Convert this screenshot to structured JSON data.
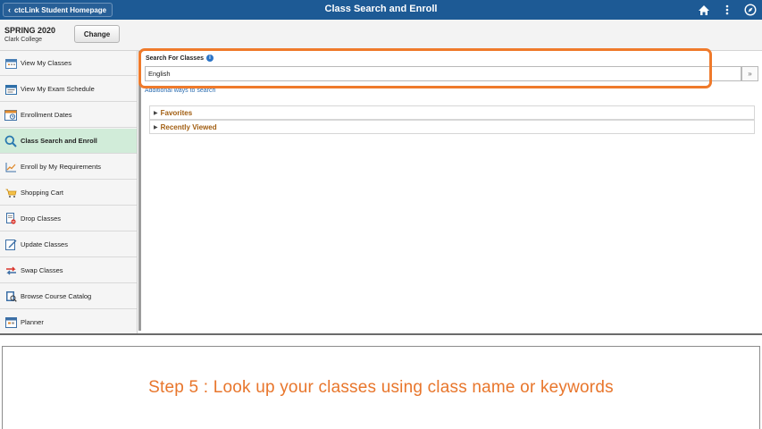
{
  "header": {
    "back_label": "ctcLink Student Homepage",
    "title": "Class Search and Enroll",
    "icons": [
      "home-icon",
      "more-options-icon",
      "navbar-compass-icon"
    ]
  },
  "term": {
    "name": "SPRING 2020",
    "school": "Clark College",
    "change_label": "Change"
  },
  "sidebar": {
    "items": [
      {
        "label": "View My Classes",
        "icon": "calendar-icon"
      },
      {
        "label": "View My Exam Schedule",
        "icon": "exam-calendar-icon"
      },
      {
        "label": "Enrollment Dates",
        "icon": "enrollment-calendar-icon"
      },
      {
        "label": "Class Search and Enroll",
        "icon": "search-icon",
        "active": true
      },
      {
        "label": "Enroll by My Requirements",
        "icon": "chart-line-icon"
      },
      {
        "label": "Shopping Cart",
        "icon": "shopping-cart-icon"
      },
      {
        "label": "Drop Classes",
        "icon": "drop-classes-icon"
      },
      {
        "label": "Update Classes",
        "icon": "update-classes-icon"
      },
      {
        "label": "Swap Classes",
        "icon": "swap-arrows-icon"
      },
      {
        "label": "Browse Course Catalog",
        "icon": "catalog-book-icon"
      },
      {
        "label": "Planner",
        "icon": "planner-icon"
      }
    ]
  },
  "search": {
    "label": "Search For Classes",
    "value": "English",
    "go_label": "»",
    "additional_ways": "Additional ways to search"
  },
  "sections": {
    "favorites": "Favorites",
    "recently_viewed": "Recently Viewed"
  },
  "caption": {
    "text": "Step 5 : Look up your classes using class name or keywords"
  },
  "colors": {
    "header_bg": "#1d5a95",
    "highlight": "#ef7a2b",
    "active_nav": "#d1ecd9",
    "section_text": "#a15d10",
    "caption_text": "#e8762c"
  }
}
